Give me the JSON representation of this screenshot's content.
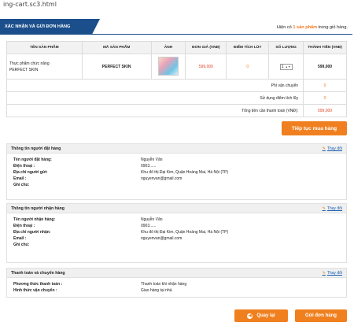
{
  "browser": {
    "url_fragment": "ing-cart.sc3.html"
  },
  "header": {
    "tab_title": "XÁC NHẬN VÀ GỬI ĐƠN HÀNG",
    "cart_prefix": "Hiện có ",
    "cart_count": "1 sản phẩm",
    "cart_suffix": " trong giỏ hàng."
  },
  "cart": {
    "columns": [
      "TÊN SẢN PHẨM",
      "MÃ SẢN PHẨM",
      "ẢNH",
      "ĐƠN GIÁ (VNĐ)",
      "ĐIỂM TÍCH LŨY",
      "SỐ LƯỢNG",
      "THÀNH TIỀN (VNĐ)"
    ],
    "item": {
      "name_line1": "Thực phẩm chức năng",
      "name_line2": "PERFECT SKIN",
      "code": "PERFECT SKIN",
      "unit_price": "599,000",
      "points": "0",
      "quantity": "1",
      "total": "599,000"
    },
    "summary": {
      "shipping_label": "Phí vận chuyển",
      "shipping_value": "0",
      "points_label": "Sử dụng điểm tích lũy",
      "points_value": "0",
      "grand_label": "Tổng tiền cần thanh toán (VNĐ):",
      "grand_value": "599,000"
    }
  },
  "continue_button": "Tiếp tục mua hàng",
  "orderer": {
    "title": "Thông tin người đặt hàng",
    "edit": "Thay đổi",
    "rows": [
      {
        "label": "Tên người đặt hàng:",
        "value": "Nguyễn Văn"
      },
      {
        "label": "Điện thoại :",
        "value": "0903......"
      },
      {
        "label": "Địa chỉ người gửi:",
        "value": "Khu đô thị Đại Kim, Quận Hoàng Mai, Hà Nội (TP)"
      },
      {
        "label": "Email :",
        "value": "nguyenvan@gmail.com"
      },
      {
        "label": "Ghi chú:",
        "value": ""
      }
    ]
  },
  "receiver": {
    "title": "Thông tin người nhận hàng",
    "edit": "Thay đổi",
    "rows": [
      {
        "label": "Tên người nhận hàng:",
        "value": "Nguyễn Văn"
      },
      {
        "label": "Điện thoại :",
        "value": "0903......"
      },
      {
        "label": "Địa chỉ người nhận:",
        "value": "Khu đô thị Đại Kim, Quận Hoàng Mai, Hà Nội (TP)"
      },
      {
        "label": "Email :",
        "value": "nguyenvan@gmail.com"
      },
      {
        "label": "Ghi chú:",
        "value": ""
      }
    ]
  },
  "payment": {
    "title": "Thanh toán và chuyển hàng",
    "edit": "Thay đổi",
    "rows": [
      {
        "label": "Phương thức thanh toán :",
        "value": "Thanh toán khi nhận hàng"
      },
      {
        "label": "Hình thức vận chuyển :",
        "value": "Giao hàng tại nhà"
      }
    ]
  },
  "buttons": {
    "back": "Quay lại",
    "submit": "Gửi đơn hàng"
  },
  "colors": {
    "header_blue": "#1b4f8c",
    "accent_orange": "#f0801f",
    "price_red": "#e0482b",
    "link_blue": "#1a5fb4"
  }
}
